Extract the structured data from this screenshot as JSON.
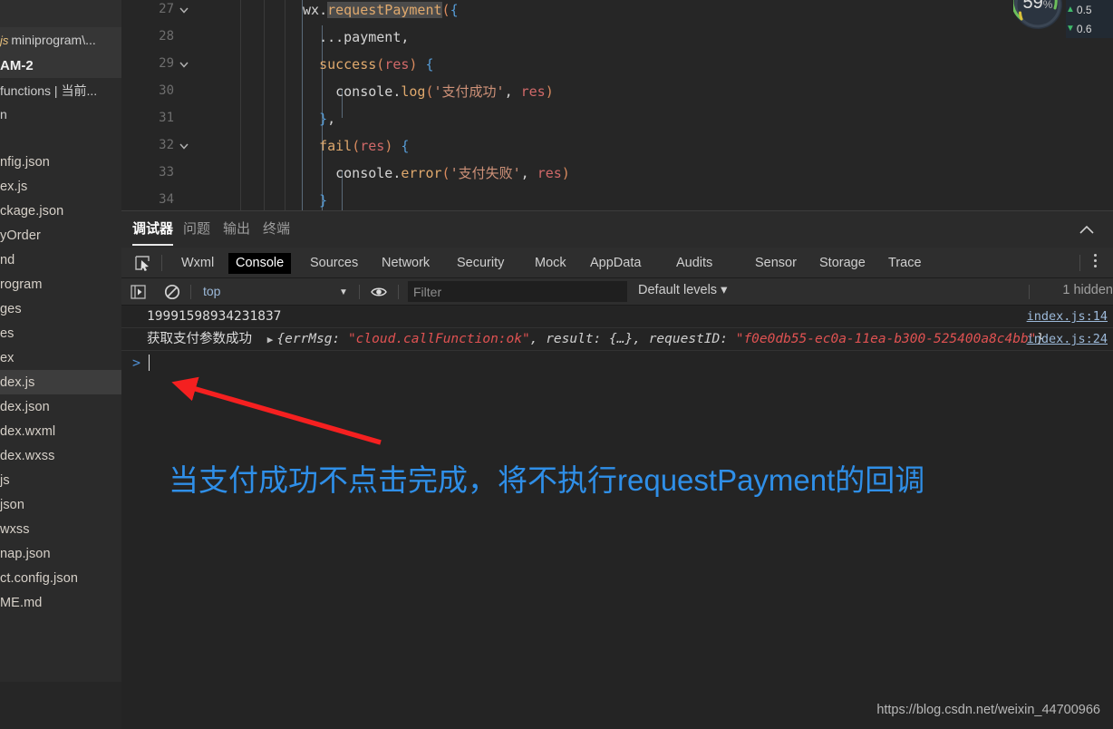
{
  "sidebar": {
    "breadcrumbs": [
      {
        "id": "file",
        "js_badge": "js",
        "label": "miniprogram\\..."
      },
      {
        "id": "am",
        "label": "AM-2"
      },
      {
        "id": "fn",
        "label": "functions | 当前..."
      },
      {
        "id": "n",
        "label": "n"
      }
    ],
    "files": [
      {
        "label": "nfig.json",
        "selected": false
      },
      {
        "label": "ex.js",
        "selected": false
      },
      {
        "label": "ckage.json",
        "selected": false
      },
      {
        "label": "yOrder",
        "selected": false
      },
      {
        "label": "nd",
        "selected": false
      },
      {
        "label": "rogram",
        "selected": false
      },
      {
        "label": "ges",
        "selected": false
      },
      {
        "label": "es",
        "selected": false
      },
      {
        "label": "ex",
        "selected": false
      },
      {
        "label": "dex.js",
        "selected": true
      },
      {
        "label": "dex.json",
        "selected": false
      },
      {
        "label": "dex.wxml",
        "selected": false
      },
      {
        "label": "dex.wxss",
        "selected": false
      },
      {
        "label": "js",
        "selected": false
      },
      {
        "label": "json",
        "selected": false
      },
      {
        "label": "wxss",
        "selected": false
      },
      {
        "label": "nap.json",
        "selected": false
      },
      {
        "label": "ct.config.json",
        "selected": false
      },
      {
        "label": "ME.md",
        "selected": false
      }
    ]
  },
  "editor": {
    "lines": [
      {
        "number": "27",
        "fold": true,
        "code": "wx.requestPayment({"
      },
      {
        "number": "28",
        "fold": false,
        "code": "  ...payment,"
      },
      {
        "number": "29",
        "fold": true,
        "code": "  success(res) {"
      },
      {
        "number": "30",
        "fold": false,
        "code": "    console.log('支付成功', res)"
      },
      {
        "number": "31",
        "fold": false,
        "code": "  },"
      },
      {
        "number": "32",
        "fold": true,
        "code": "  fail(res) {"
      },
      {
        "number": "33",
        "fold": false,
        "code": "    console.error('支付失败', res)"
      },
      {
        "number": "34",
        "fold": false,
        "code": "  }"
      }
    ],
    "selected_token": "requestPayment"
  },
  "devtools": {
    "cn_tabs": [
      {
        "label": "调试器",
        "active": true
      },
      {
        "label": "问题",
        "active": false
      },
      {
        "label": "输出",
        "active": false
      },
      {
        "label": "终端",
        "active": false
      }
    ],
    "tabs": [
      {
        "label": "Wxml",
        "active": false
      },
      {
        "label": "Console",
        "active": true
      },
      {
        "label": "Sources",
        "active": false
      },
      {
        "label": "Network",
        "active": false
      },
      {
        "label": "Security",
        "active": false
      },
      {
        "label": "Mock",
        "active": false
      },
      {
        "label": "AppData",
        "active": false
      },
      {
        "label": "Audits",
        "active": false
      },
      {
        "label": "Sensor",
        "active": false
      },
      {
        "label": "Storage",
        "active": false
      },
      {
        "label": "Trace",
        "active": false
      }
    ],
    "console_toolbar": {
      "context": "top",
      "filter_placeholder": "Filter",
      "filter_value": "",
      "levels": "Default levels ▾",
      "hidden": "1 hidden"
    },
    "logs": [
      {
        "message": "19991598934231837",
        "source": "index.js:14",
        "type": "plain"
      },
      {
        "prefix": "获取支付参数成功",
        "object_open": "{",
        "key1": "errMsg: ",
        "val1": "\"cloud.callFunction:ok\"",
        "mid": ", result: {…}, ",
        "key2": "requestID: ",
        "val2": "\"f0e0db55-ec0a-11ea-b300-525400a8c4bb\"",
        "object_close": "}",
        "source": "index.js:24",
        "type": "object"
      }
    ],
    "prompt": ">"
  },
  "annotation": {
    "text": "当支付成功不点击完成，将不执行requestPayment的回调",
    "color": "#2f8fe8",
    "arrow_color": "#f52020"
  },
  "watermark": "https://blog.csdn.net/weixin_44700966",
  "perf_widget": {
    "value": "59",
    "unit": "%",
    "ring_color": "#6dbf5c"
  },
  "stock_panel": {
    "rows": [
      {
        "arrow": "▲",
        "value": "0.5"
      },
      {
        "arrow": "▼",
        "value": "0.6"
      }
    ]
  }
}
